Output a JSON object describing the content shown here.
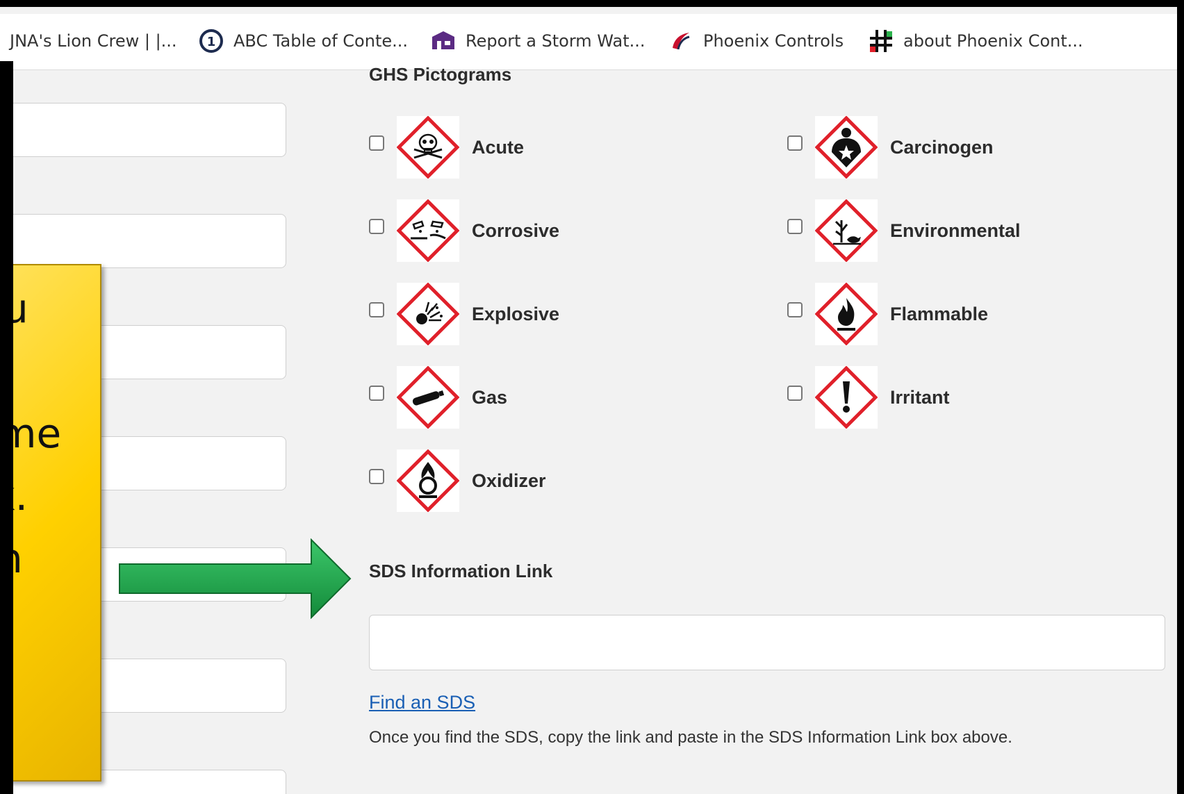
{
  "bookmarks": [
    {
      "label": "JNA's Lion Crew | |...",
      "icon": "lion-icon"
    },
    {
      "label": "ABC Table of Conte...",
      "icon": "circle-one-icon"
    },
    {
      "label": "Report a Storm Wat...",
      "icon": "building-icon"
    },
    {
      "label": "Phoenix Controls",
      "icon": "phoenix-logo-icon"
    },
    {
      "label": "about Phoenix Cont...",
      "icon": "grid-logo-icon"
    }
  ],
  "ghs": {
    "title": "GHS Pictograms",
    "items": [
      {
        "label": "Acute",
        "icon": "skull-crossbones-icon"
      },
      {
        "label": "Carcinogen",
        "icon": "health-hazard-icon"
      },
      {
        "label": "Corrosive",
        "icon": "corrosion-icon"
      },
      {
        "label": "Environmental",
        "icon": "environment-icon"
      },
      {
        "label": "Explosive",
        "icon": "exploding-bomb-icon"
      },
      {
        "label": "Flammable",
        "icon": "flame-icon"
      },
      {
        "label": "Gas",
        "icon": "gas-cylinder-icon"
      },
      {
        "label": "Irritant",
        "icon": "exclamation-mark-icon"
      },
      {
        "label": "Oxidizer",
        "icon": "flame-over-circle-icon"
      }
    ]
  },
  "sds": {
    "title": "SDS Information Link",
    "input_value": "",
    "find_link": "Find an SDS",
    "help": "Once you find the SDS, copy the link and paste in the SDS Information Link box above."
  },
  "callout": {
    "lines": [
      "u",
      "",
      "me",
      "k.",
      "n"
    ]
  },
  "colors": {
    "callout_bg": "#ffd000",
    "arrow": "#1fa84a",
    "hazard_red": "#e0202a",
    "link": "#1a5fb4"
  }
}
